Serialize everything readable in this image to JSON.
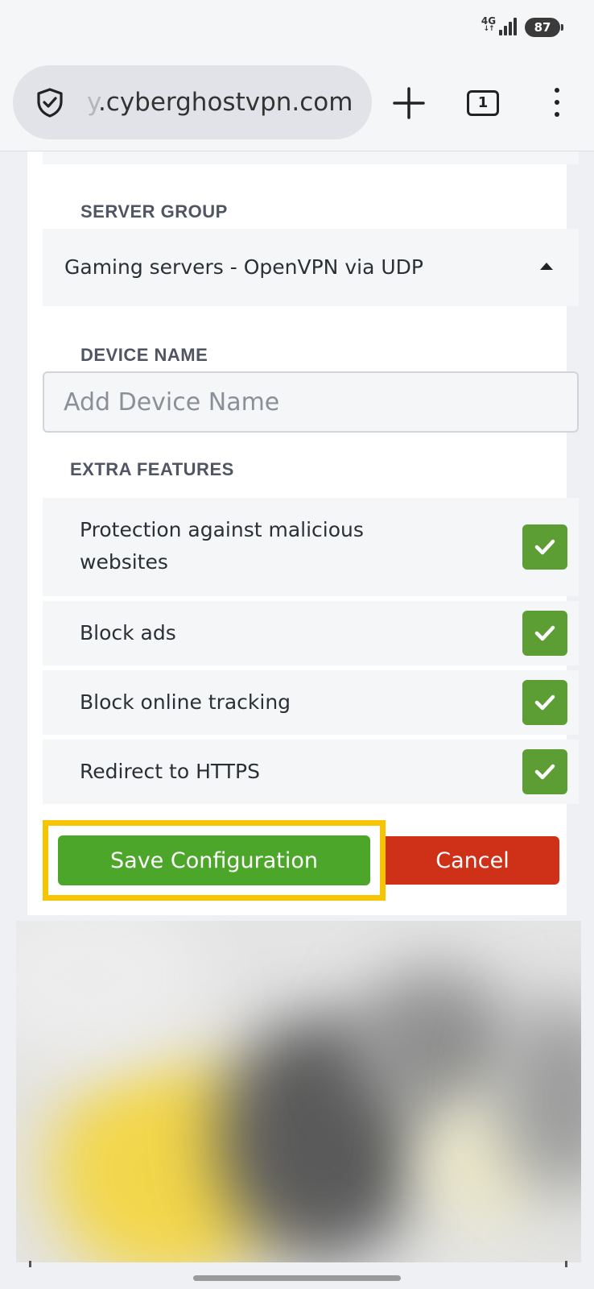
{
  "status_bar": {
    "network": "4G",
    "battery": "87"
  },
  "browser": {
    "url_visible": "y.cyberghostvpn.com",
    "url_faded_prefix": "y",
    "url_main": ".cyberghostvpn.com",
    "tab_count": "1",
    "icons": [
      "shield-icon",
      "plus-icon",
      "tabs-icon",
      "menu-icon"
    ]
  },
  "form": {
    "server_group": {
      "label": "SERVER GROUP",
      "selected": "Gaming servers - OpenVPN via UDP"
    },
    "device_name": {
      "label": "DEVICE NAME",
      "placeholder": "Add Device Name",
      "value": ""
    },
    "extra_features": {
      "label": "EXTRA FEATURES",
      "items": [
        {
          "label": "Protection against malicious websites",
          "checked": true
        },
        {
          "label": "Block ads",
          "checked": true
        },
        {
          "label": "Block online tracking",
          "checked": true
        },
        {
          "label": "Redirect to HTTPS",
          "checked": true
        }
      ]
    },
    "buttons": {
      "save_label": "Save Configuration",
      "cancel_label": "Cancel"
    }
  },
  "colors": {
    "save": "#4ba62a",
    "cancel": "#cf3118",
    "checkbox": "#5c9e34",
    "highlight": "#f6c400"
  }
}
